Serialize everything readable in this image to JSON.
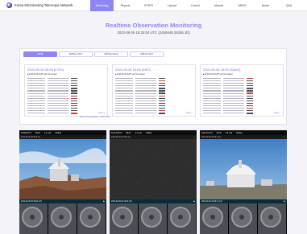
{
  "brand": {
    "name": "Korea Microlensing Telescope Network"
  },
  "nav": [
    {
      "label": "Monitoring",
      "active": true
    },
    {
      "label": "Reports",
      "active": false
    },
    {
      "label": "STSPS",
      "active": false
    },
    {
      "label": "Upload",
      "active": false
    },
    {
      "label": "Control",
      "active": false
    },
    {
      "label": "Manual",
      "active": false
    },
    {
      "label": "NEWS",
      "active": false
    },
    {
      "label": "Notice",
      "active": false
    },
    {
      "label": "Q&A",
      "active": false
    }
  ],
  "header": {
    "title": "Realtime Observation Monitoring",
    "subtitle": "2022-09-26 18:30:04 UTC (2459849.26255 JD)"
  },
  "tabs": [
    {
      "label": "KMTA",
      "active": true
    },
    {
      "label": "KMTNet CTIO",
      "active": false
    },
    {
      "label": "KMTNet SAAO",
      "active": false
    },
    {
      "label": "KMTNet SSO",
      "active": false
    }
  ],
  "observations": [
    {
      "time": "2022-09-26 05:28 (CTIO)",
      "header": "■ 2022-09-26 (KMT obs-Tel) (target)",
      "link": "more  △"
    },
    {
      "time": "2022-09-26 18:28 (SSO)",
      "header": "■ 2022-09-26 (KMT obs-Tel) (target)",
      "link": "more  △"
    },
    {
      "time": "2022-09-26 18:29 (SAAO)",
      "header": "■ 2022-09-26 (KMT obs-Tel) (target)",
      "link": "more  △"
    }
  ],
  "panel_footer": "Where's last update(s) - CTIO, SAAO",
  "cameras": [
    {
      "temp": "18.0±0.0°C",
      "humidity": "53 %",
      "wind": "1.1 m/s",
      "status": "Online",
      "date": "2022-09-26 05:28 (Loc)",
      "label": "2022-09-26  05:28:00 (LT)"
    },
    {
      "temp": "11.8 ±0.0°C",
      "humidity": "58 %",
      "wind": "1.1 m/s",
      "status": "Online",
      "date": "2022-09-26 18:28 (Loc)",
      "label": "2022-09-26  02:16:09 (LT)"
    },
    {
      "temp": "14.6 ±1.0°C",
      "humidity": "29 %",
      "wind": "1.6 m/s",
      "status": "Online",
      "date": "2022-09-26 18:29 (Loc)",
      "label": "2022-09-26  18:29:12 (LT)"
    }
  ]
}
